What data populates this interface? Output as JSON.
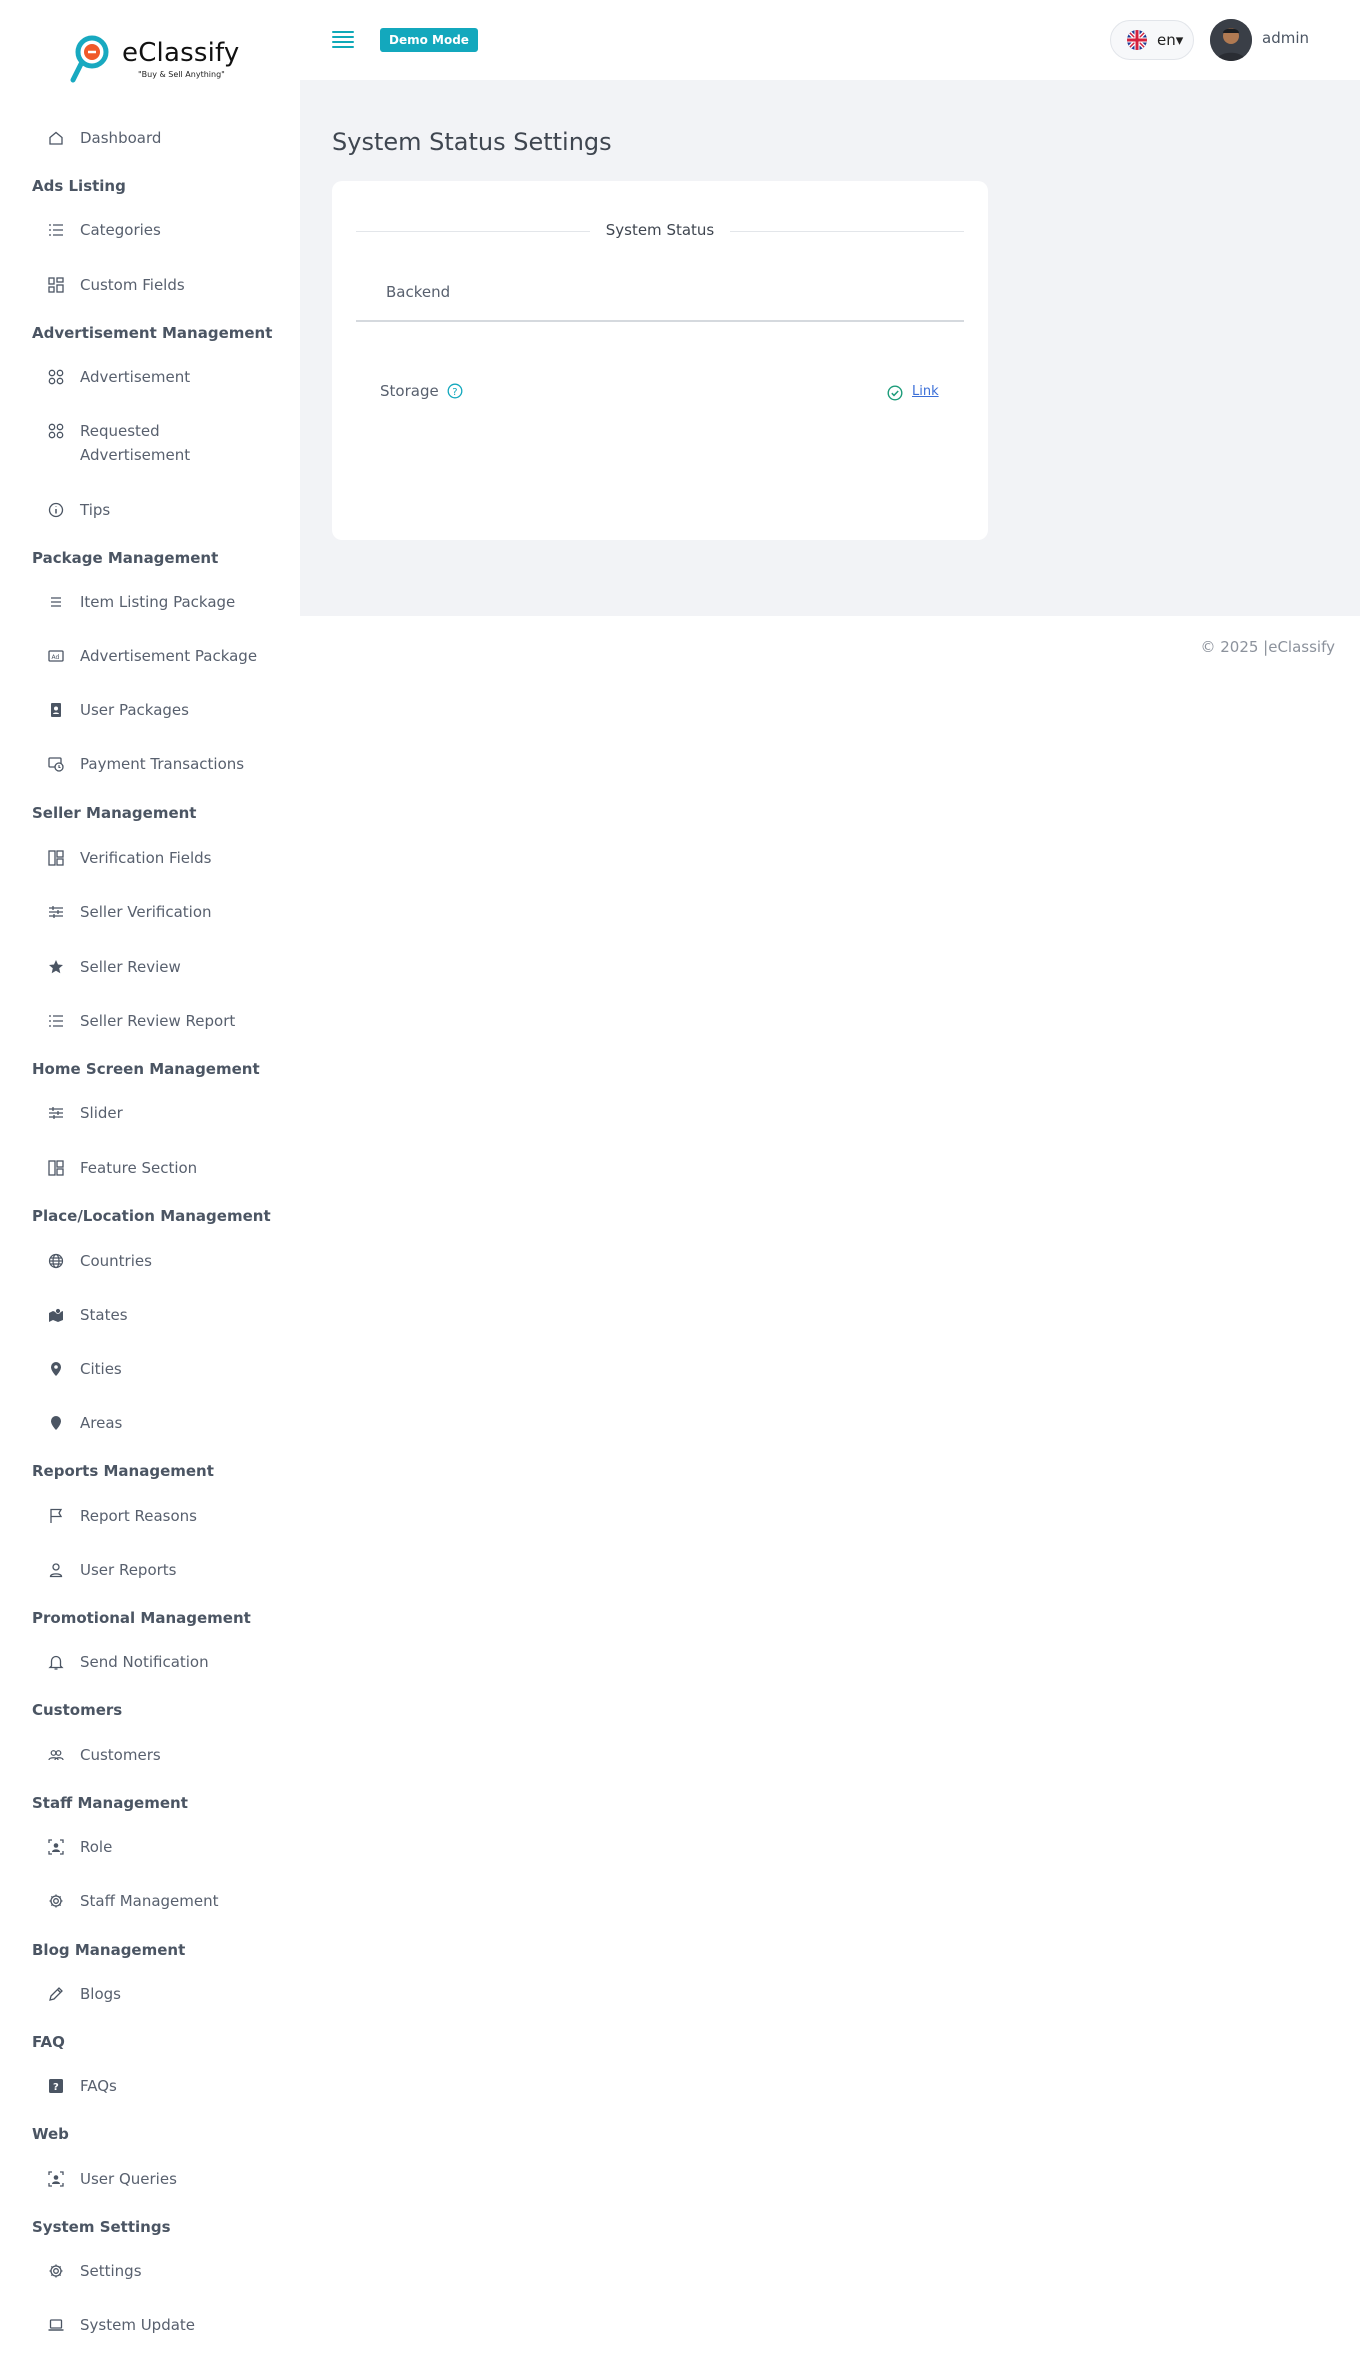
{
  "brand": {
    "name": "eClassify",
    "tagline": "\"Buy & Sell Anything\""
  },
  "topbar": {
    "mode_badge": "Demo Mode",
    "language": "en▾",
    "user": "admin"
  },
  "sidebar": {
    "dashboard": "Dashboard",
    "sections": [
      {
        "heading": "Ads Listing",
        "items": [
          "Categories",
          "Custom Fields"
        ]
      },
      {
        "heading": "Advertisement Management",
        "items": [
          "Advertisement",
          "Requested Advertisement",
          "Tips"
        ]
      },
      {
        "heading": "Package Management",
        "items": [
          "Item Listing Package",
          "Advertisement Package",
          "User Packages",
          "Payment Transactions"
        ]
      },
      {
        "heading": "Seller Management",
        "items": [
          "Verification Fields",
          "Seller Verification",
          "Seller Review",
          "Seller Review Report"
        ]
      },
      {
        "heading": "Home Screen Management",
        "items": [
          "Slider",
          "Feature Section"
        ]
      },
      {
        "heading": "Place/Location Management",
        "items": [
          "Countries",
          "States",
          "Cities",
          "Areas"
        ]
      },
      {
        "heading": "Reports Management",
        "items": [
          "Report Reasons",
          "User Reports"
        ]
      },
      {
        "heading": "Promotional Management",
        "items": [
          "Send Notification"
        ]
      },
      {
        "heading": "Customers",
        "items": [
          "Customers"
        ]
      },
      {
        "heading": "Staff Management",
        "items": [
          "Role",
          "Staff Management"
        ]
      },
      {
        "heading": "Blog Management",
        "items": [
          "Blogs"
        ]
      },
      {
        "heading": "FAQ",
        "items": [
          "FAQs"
        ]
      },
      {
        "heading": "Web",
        "items": [
          "User Queries"
        ]
      },
      {
        "heading": "System Settings",
        "items": [
          "Settings",
          "System Update"
        ]
      }
    ]
  },
  "main": {
    "title": "System Status Settings",
    "card": {
      "section_title": "System Status",
      "tab": "Backend",
      "rows": [
        {
          "label": "Storage",
          "status": "ok",
          "link_text": "Link"
        }
      ]
    }
  },
  "footer": "© 2025 |eClassify",
  "colors": {
    "accent": "#13a8bd",
    "link": "#3b6fd8",
    "ok": "#1d9c7a"
  }
}
